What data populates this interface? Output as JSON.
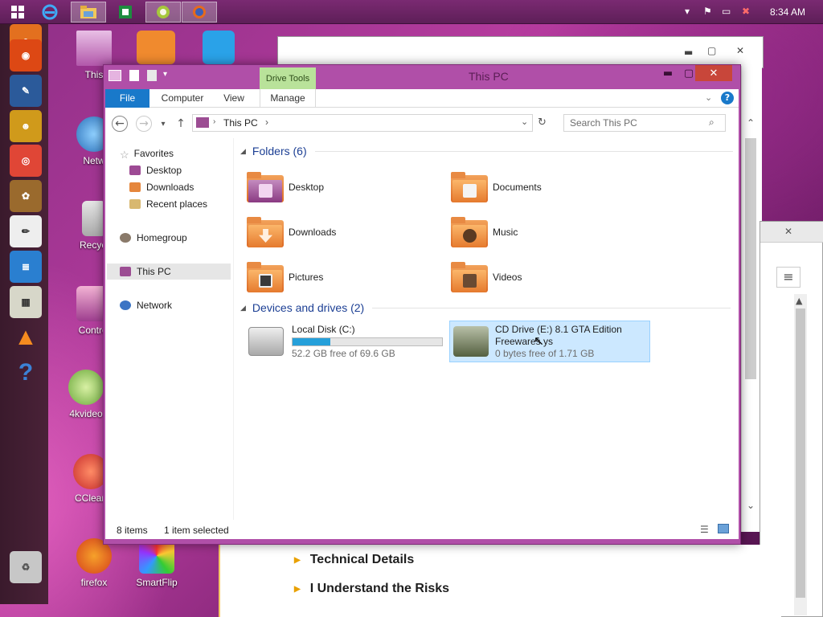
{
  "taskbar": {
    "clock": "8:34 AM",
    "apps": [
      {
        "icon": "windows-start-icon"
      },
      {
        "icon": "internet-explorer-icon"
      },
      {
        "icon": "file-explorer-icon",
        "active": true
      },
      {
        "icon": "excel-icon"
      },
      {
        "icon": "android-icon",
        "active": true
      },
      {
        "icon": "firefox-icon",
        "active": true
      }
    ],
    "tray_icons": [
      "chevron-up-icon",
      "flag-icon",
      "network-icon",
      "volume-muted-icon"
    ]
  },
  "launcher": {
    "icons": [
      "firefox-icon",
      "ubuntu-icon",
      "desktop-settings-icon",
      "people-icon",
      "chrome-icon",
      "paint-icon",
      "text-editor-icon",
      "writer-icon",
      "calculator-icon",
      "vlc-icon",
      "help-icon",
      "trash-icon"
    ]
  },
  "desktop": {
    "icons": [
      {
        "label": "This"
      },
      {
        "label": "Netw"
      },
      {
        "label": "Recycl"
      },
      {
        "label": "Control"
      },
      {
        "label": "4kvideo"
      },
      {
        "label": "CClean"
      },
      {
        "label": "firefox"
      },
      {
        "label": "SmartFlip"
      }
    ]
  },
  "explorer": {
    "title": "This PC",
    "context_tab": "Drive Tools",
    "ribbon_tabs": [
      "File",
      "Computer",
      "View",
      "Manage"
    ],
    "address": {
      "crumb": "This PC"
    },
    "search_placeholder": "Search This PC",
    "nav": {
      "favorites": "Favorites",
      "desktop": "Desktop",
      "downloads": "Downloads",
      "recent": "Recent places",
      "homegroup": "Homegroup",
      "thispc": "This PC",
      "network": "Network"
    },
    "folders_header": "Folders (6)",
    "folders": [
      {
        "name": "Desktop"
      },
      {
        "name": "Documents"
      },
      {
        "name": "Downloads"
      },
      {
        "name": "Music"
      },
      {
        "name": "Pictures"
      },
      {
        "name": "Videos"
      }
    ],
    "devices_header": "Devices and drives (2)",
    "drives": [
      {
        "name": "Local Disk (C:)",
        "free": "52.2 GB free of 69.6 GB",
        "used_fraction": 0.25
      },
      {
        "name_line1": "CD Drive (E:) 8.1 GTA Edition",
        "name_line2": "Freewares.ys",
        "free": "0 bytes free of 1.71 GB",
        "selected": true
      }
    ],
    "status": {
      "items": "8 items",
      "selected": "1 item selected"
    }
  },
  "webpage": {
    "items": [
      "Technical Details",
      "I Understand the Risks"
    ]
  },
  "colors": {
    "accent": "#1979ca",
    "selection": "#cce8ff",
    "frame": "#b04fa8"
  }
}
